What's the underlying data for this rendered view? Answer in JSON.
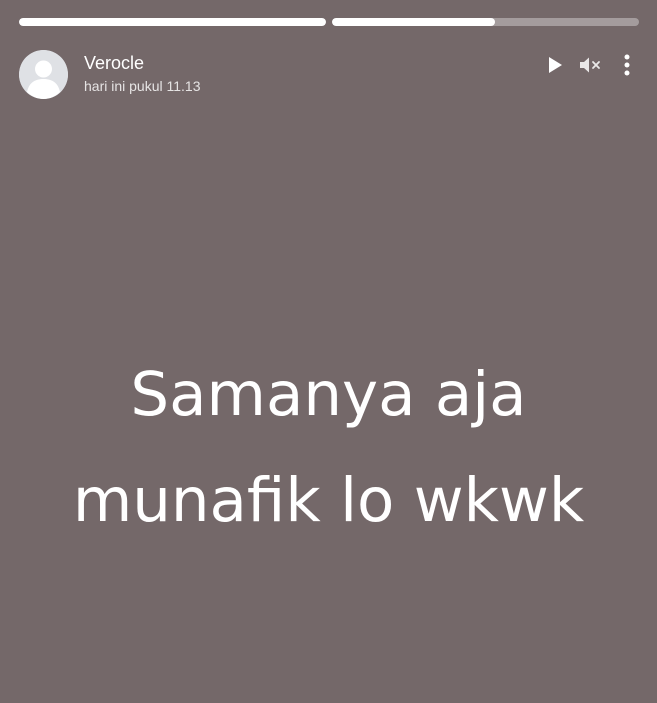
{
  "progress": [
    {
      "fill": 1.0
    },
    {
      "fill": 0.53
    }
  ],
  "header": {
    "user_name": "Verocle",
    "timestamp": "hari ini pukul 11.13",
    "icons": [
      "avatar-person-icon",
      "play-icon",
      "volume-muted-icon",
      "more-vertical-icon"
    ]
  },
  "story": {
    "line1": "Samanya aja",
    "line2": "munafik lo wkwk"
  },
  "colors": {
    "background": "#746869",
    "text": "#ffffff",
    "progress_track": "rgba(255,255,255,0.35)",
    "progress_fill": "#ffffff",
    "avatar_bg": "#dfe1e5"
  }
}
